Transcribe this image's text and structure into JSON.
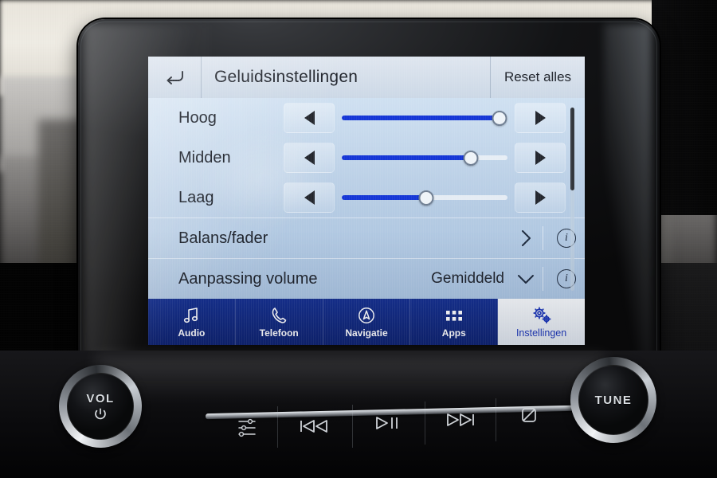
{
  "device": {
    "name": "car-infotainment-head-unit",
    "accent_blue": "#1436d6",
    "nav_bar_blue": "#15308f",
    "screen_bg": "#b9cfe6"
  },
  "titlebar": {
    "back_icon": "back-arrow-icon",
    "title": "Geluidsinstellingen",
    "reset_label": "Reset alles"
  },
  "settings_list": {
    "sliders": [
      {
        "label": "Hoog",
        "value": 95,
        "dec_icon": "triangle-left-icon",
        "inc_icon": "triangle-right-icon"
      },
      {
        "label": "Midden",
        "value": 78,
        "dec_icon": "triangle-left-icon",
        "inc_icon": "triangle-right-icon"
      },
      {
        "label": "Laag",
        "value": 51,
        "dec_icon": "triangle-left-icon",
        "inc_icon": "triangle-right-icon"
      }
    ],
    "rows": [
      {
        "label": "Balans/fader",
        "value": "",
        "chevron": "chevron-right-icon",
        "info_icon": "info-icon"
      },
      {
        "label": "Aanpassing volume",
        "value": "Gemiddeld",
        "chevron": "chevron-down-icon",
        "info_icon": "info-icon"
      }
    ],
    "scrollbar": {
      "thumb_percent": 45
    }
  },
  "navbar": {
    "items": [
      {
        "label": "Audio",
        "icon": "music-note-icon",
        "active": false
      },
      {
        "label": "Telefoon",
        "icon": "phone-icon",
        "active": false
      },
      {
        "label": "Navigatie",
        "icon": "compass-icon",
        "active": false
      },
      {
        "label": "Apps",
        "icon": "apps-grid-icon",
        "active": false
      },
      {
        "label": "Instellingen",
        "icon": "gears-icon",
        "active": true
      }
    ]
  },
  "hardware": {
    "volume_knob": {
      "label": "VOL",
      "sub_icon": "power-icon"
    },
    "tune_knob": {
      "label": "TUNE"
    },
    "buttons": [
      {
        "name": "equalizer",
        "icon": "equalizer-sliders-icon"
      },
      {
        "name": "previous",
        "icon": "previous-track-icon"
      },
      {
        "name": "play-pause",
        "icon": "play-pause-icon"
      },
      {
        "name": "next",
        "icon": "next-track-icon"
      },
      {
        "name": "display-off",
        "icon": "display-off-icon"
      }
    ]
  }
}
